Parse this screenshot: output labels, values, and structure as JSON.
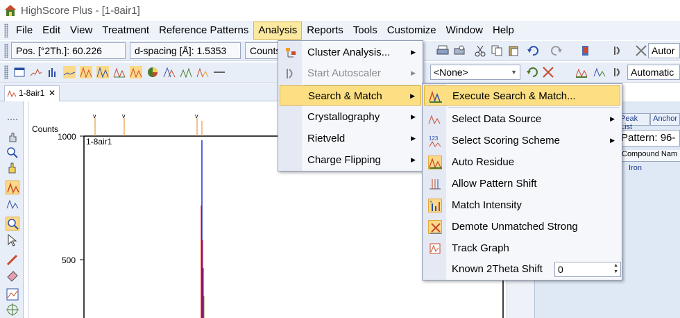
{
  "window": {
    "title": "HighScore Plus - [1-8air1]"
  },
  "menubar": {
    "items": [
      "File",
      "Edit",
      "View",
      "Treatment",
      "Reference Patterns",
      "Analysis",
      "Reports",
      "Tools",
      "Customize",
      "Window",
      "Help"
    ]
  },
  "toolbar1": {
    "pos": "Pos. [°2Th.]: 60.226",
    "dspacing": "d-spacing [Å]: 1.5353",
    "counts": "Counts",
    "combo_right": "Autor"
  },
  "toolbar2": {
    "combo_none": "<None>",
    "combo_automatic": "Automatic"
  },
  "document_tab": {
    "label": "1-8air1",
    "close": "✕"
  },
  "plot": {
    "y_axis_title": "Counts",
    "y_ticks": [
      "1000",
      "500"
    ],
    "pattern_label": "1-8air1"
  },
  "analysis_menu": {
    "items": [
      {
        "label": "Cluster Analysis...",
        "submenu": true,
        "enabled": true
      },
      {
        "label": "Start Autoscaler",
        "submenu": true,
        "enabled": false
      },
      {
        "label": "Search & Match",
        "submenu": true,
        "enabled": true,
        "highlighted": true
      },
      {
        "label": "Crystallography",
        "submenu": true,
        "enabled": true
      },
      {
        "label": "Rietveld",
        "submenu": true,
        "enabled": true
      },
      {
        "label": "Charge Flipping",
        "submenu": true,
        "enabled": true
      }
    ]
  },
  "search_match_menu": {
    "items": [
      {
        "label": "Execute Search & Match...",
        "highlighted": true
      },
      {
        "label": "Select Data Source",
        "submenu": true
      },
      {
        "label": "Select Scoring Scheme",
        "submenu": true
      },
      {
        "label": "Auto Residue",
        "checked": true
      },
      {
        "label": "Allow Pattern Shift"
      },
      {
        "label": "Match Intensity",
        "checked": true
      },
      {
        "label": "Demote Unmatched Strong",
        "checked": true
      },
      {
        "label": "Track Graph"
      },
      {
        "label": "Known 2Theta Shift",
        "value": "0"
      }
    ]
  },
  "right_panel": {
    "tabs": [
      "Peak List",
      "Anchor"
    ],
    "pattern_label": "Pattern: 96-",
    "column_header": "Compound Nam",
    "row_value": "Iron"
  },
  "colors": {
    "menu_highlight": "#fcdf83",
    "menubar_bg": "#eef3fa",
    "trace_red": "#e8001c",
    "trace_blue": "#1f33d6",
    "marker_orange": "#e08a1e"
  }
}
